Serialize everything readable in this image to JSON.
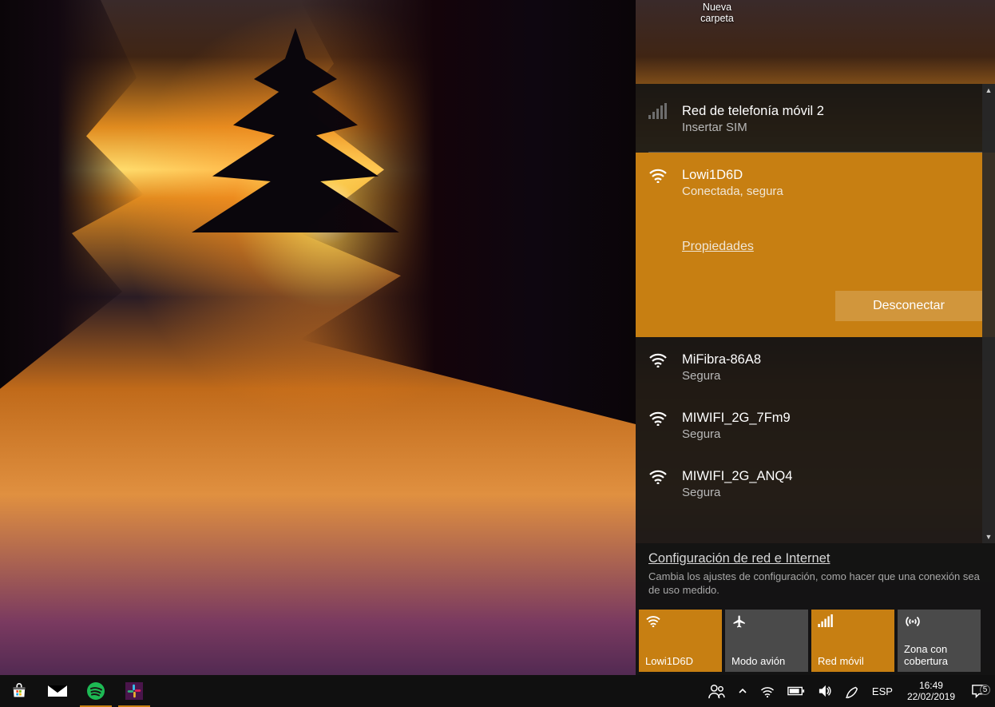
{
  "desktop": {
    "folder_label": "Nueva\ncarpeta"
  },
  "flyout": {
    "cellular": {
      "name": "Red de telefonía móvil 2",
      "sub": "Insertar SIM"
    },
    "connected": {
      "name": "Lowi1D6D",
      "sub": "Conectada, segura",
      "properties": "Propiedades",
      "disconnect": "Desconectar"
    },
    "networks": [
      {
        "name": "MiFibra-86A8",
        "sub": "Segura"
      },
      {
        "name": "MIWIFI_2G_7Fm9",
        "sub": "Segura"
      },
      {
        "name": "MIWIFI_2G_ANQ4",
        "sub": "Segura"
      }
    ],
    "settings_link": "Configuración de red e Internet",
    "settings_desc": "Cambia los ajustes de configuración, como hacer que una conexión sea de uso medido.",
    "tiles": {
      "wifi": "Lowi1D6D",
      "airplane": "Modo avión",
      "cellular": "Red móvil",
      "hotspot": "Zona con cobertura"
    }
  },
  "taskbar": {
    "lang": "ESP",
    "time": "16:49",
    "date": "22/02/2019",
    "notif_count": "5"
  }
}
